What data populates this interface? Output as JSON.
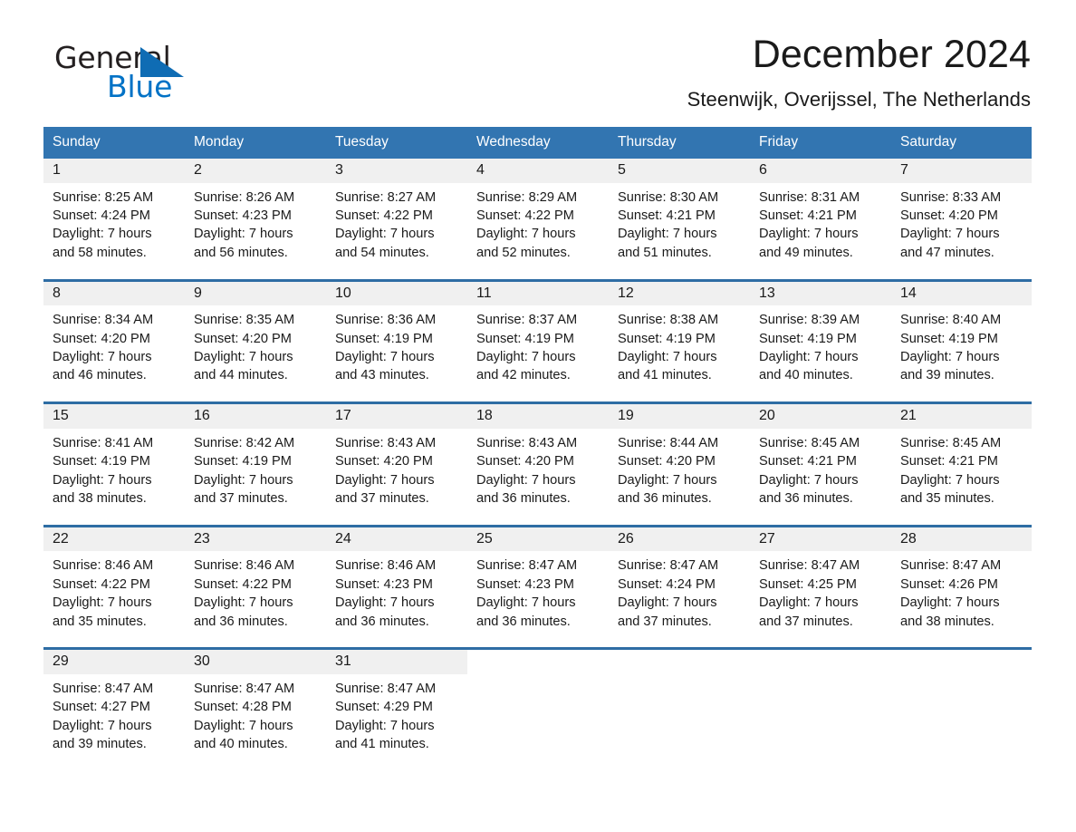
{
  "brand": {
    "name_part1": "General",
    "name_part2": "Blue",
    "triangle_color": "#0f6cb4",
    "blue_text_color": "#0072c6"
  },
  "header": {
    "title": "December 2024",
    "location": "Steenwijk, Overijssel, The Netherlands"
  },
  "theme": {
    "header_blue": "#3275b1",
    "week_separator_blue": "#2e6da4",
    "daynum_band": "#f0f0f0",
    "page_background": "#ffffff"
  },
  "calendar": {
    "weekday_headers": [
      "Sunday",
      "Monday",
      "Tuesday",
      "Wednesday",
      "Thursday",
      "Friday",
      "Saturday"
    ],
    "weeks": [
      [
        {
          "day": "1",
          "sunrise": "Sunrise: 8:25 AM",
          "sunset": "Sunset: 4:24 PM",
          "daylight_1": "Daylight: 7 hours",
          "daylight_2": "and 58 minutes."
        },
        {
          "day": "2",
          "sunrise": "Sunrise: 8:26 AM",
          "sunset": "Sunset: 4:23 PM",
          "daylight_1": "Daylight: 7 hours",
          "daylight_2": "and 56 minutes."
        },
        {
          "day": "3",
          "sunrise": "Sunrise: 8:27 AM",
          "sunset": "Sunset: 4:22 PM",
          "daylight_1": "Daylight: 7 hours",
          "daylight_2": "and 54 minutes."
        },
        {
          "day": "4",
          "sunrise": "Sunrise: 8:29 AM",
          "sunset": "Sunset: 4:22 PM",
          "daylight_1": "Daylight: 7 hours",
          "daylight_2": "and 52 minutes."
        },
        {
          "day": "5",
          "sunrise": "Sunrise: 8:30 AM",
          "sunset": "Sunset: 4:21 PM",
          "daylight_1": "Daylight: 7 hours",
          "daylight_2": "and 51 minutes."
        },
        {
          "day": "6",
          "sunrise": "Sunrise: 8:31 AM",
          "sunset": "Sunset: 4:21 PM",
          "daylight_1": "Daylight: 7 hours",
          "daylight_2": "and 49 minutes."
        },
        {
          "day": "7",
          "sunrise": "Sunrise: 8:33 AM",
          "sunset": "Sunset: 4:20 PM",
          "daylight_1": "Daylight: 7 hours",
          "daylight_2": "and 47 minutes."
        }
      ],
      [
        {
          "day": "8",
          "sunrise": "Sunrise: 8:34 AM",
          "sunset": "Sunset: 4:20 PM",
          "daylight_1": "Daylight: 7 hours",
          "daylight_2": "and 46 minutes."
        },
        {
          "day": "9",
          "sunrise": "Sunrise: 8:35 AM",
          "sunset": "Sunset: 4:20 PM",
          "daylight_1": "Daylight: 7 hours",
          "daylight_2": "and 44 minutes."
        },
        {
          "day": "10",
          "sunrise": "Sunrise: 8:36 AM",
          "sunset": "Sunset: 4:19 PM",
          "daylight_1": "Daylight: 7 hours",
          "daylight_2": "and 43 minutes."
        },
        {
          "day": "11",
          "sunrise": "Sunrise: 8:37 AM",
          "sunset": "Sunset: 4:19 PM",
          "daylight_1": "Daylight: 7 hours",
          "daylight_2": "and 42 minutes."
        },
        {
          "day": "12",
          "sunrise": "Sunrise: 8:38 AM",
          "sunset": "Sunset: 4:19 PM",
          "daylight_1": "Daylight: 7 hours",
          "daylight_2": "and 41 minutes."
        },
        {
          "day": "13",
          "sunrise": "Sunrise: 8:39 AM",
          "sunset": "Sunset: 4:19 PM",
          "daylight_1": "Daylight: 7 hours",
          "daylight_2": "and 40 minutes."
        },
        {
          "day": "14",
          "sunrise": "Sunrise: 8:40 AM",
          "sunset": "Sunset: 4:19 PM",
          "daylight_1": "Daylight: 7 hours",
          "daylight_2": "and 39 minutes."
        }
      ],
      [
        {
          "day": "15",
          "sunrise": "Sunrise: 8:41 AM",
          "sunset": "Sunset: 4:19 PM",
          "daylight_1": "Daylight: 7 hours",
          "daylight_2": "and 38 minutes."
        },
        {
          "day": "16",
          "sunrise": "Sunrise: 8:42 AM",
          "sunset": "Sunset: 4:19 PM",
          "daylight_1": "Daylight: 7 hours",
          "daylight_2": "and 37 minutes."
        },
        {
          "day": "17",
          "sunrise": "Sunrise: 8:43 AM",
          "sunset": "Sunset: 4:20 PM",
          "daylight_1": "Daylight: 7 hours",
          "daylight_2": "and 37 minutes."
        },
        {
          "day": "18",
          "sunrise": "Sunrise: 8:43 AM",
          "sunset": "Sunset: 4:20 PM",
          "daylight_1": "Daylight: 7 hours",
          "daylight_2": "and 36 minutes."
        },
        {
          "day": "19",
          "sunrise": "Sunrise: 8:44 AM",
          "sunset": "Sunset: 4:20 PM",
          "daylight_1": "Daylight: 7 hours",
          "daylight_2": "and 36 minutes."
        },
        {
          "day": "20",
          "sunrise": "Sunrise: 8:45 AM",
          "sunset": "Sunset: 4:21 PM",
          "daylight_1": "Daylight: 7 hours",
          "daylight_2": "and 36 minutes."
        },
        {
          "day": "21",
          "sunrise": "Sunrise: 8:45 AM",
          "sunset": "Sunset: 4:21 PM",
          "daylight_1": "Daylight: 7 hours",
          "daylight_2": "and 35 minutes."
        }
      ],
      [
        {
          "day": "22",
          "sunrise": "Sunrise: 8:46 AM",
          "sunset": "Sunset: 4:22 PM",
          "daylight_1": "Daylight: 7 hours",
          "daylight_2": "and 35 minutes."
        },
        {
          "day": "23",
          "sunrise": "Sunrise: 8:46 AM",
          "sunset": "Sunset: 4:22 PM",
          "daylight_1": "Daylight: 7 hours",
          "daylight_2": "and 36 minutes."
        },
        {
          "day": "24",
          "sunrise": "Sunrise: 8:46 AM",
          "sunset": "Sunset: 4:23 PM",
          "daylight_1": "Daylight: 7 hours",
          "daylight_2": "and 36 minutes."
        },
        {
          "day": "25",
          "sunrise": "Sunrise: 8:47 AM",
          "sunset": "Sunset: 4:23 PM",
          "daylight_1": "Daylight: 7 hours",
          "daylight_2": "and 36 minutes."
        },
        {
          "day": "26",
          "sunrise": "Sunrise: 8:47 AM",
          "sunset": "Sunset: 4:24 PM",
          "daylight_1": "Daylight: 7 hours",
          "daylight_2": "and 37 minutes."
        },
        {
          "day": "27",
          "sunrise": "Sunrise: 8:47 AM",
          "sunset": "Sunset: 4:25 PM",
          "daylight_1": "Daylight: 7 hours",
          "daylight_2": "and 37 minutes."
        },
        {
          "day": "28",
          "sunrise": "Sunrise: 8:47 AM",
          "sunset": "Sunset: 4:26 PM",
          "daylight_1": "Daylight: 7 hours",
          "daylight_2": "and 38 minutes."
        }
      ],
      [
        {
          "day": "29",
          "sunrise": "Sunrise: 8:47 AM",
          "sunset": "Sunset: 4:27 PM",
          "daylight_1": "Daylight: 7 hours",
          "daylight_2": "and 39 minutes."
        },
        {
          "day": "30",
          "sunrise": "Sunrise: 8:47 AM",
          "sunset": "Sunset: 4:28 PM",
          "daylight_1": "Daylight: 7 hours",
          "daylight_2": "and 40 minutes."
        },
        {
          "day": "31",
          "sunrise": "Sunrise: 8:47 AM",
          "sunset": "Sunset: 4:29 PM",
          "daylight_1": "Daylight: 7 hours",
          "daylight_2": "and 41 minutes."
        },
        {
          "day": "",
          "sunrise": "",
          "sunset": "",
          "daylight_1": "",
          "daylight_2": ""
        },
        {
          "day": "",
          "sunrise": "",
          "sunset": "",
          "daylight_1": "",
          "daylight_2": ""
        },
        {
          "day": "",
          "sunrise": "",
          "sunset": "",
          "daylight_1": "",
          "daylight_2": ""
        },
        {
          "day": "",
          "sunrise": "",
          "sunset": "",
          "daylight_1": "",
          "daylight_2": ""
        }
      ]
    ]
  }
}
